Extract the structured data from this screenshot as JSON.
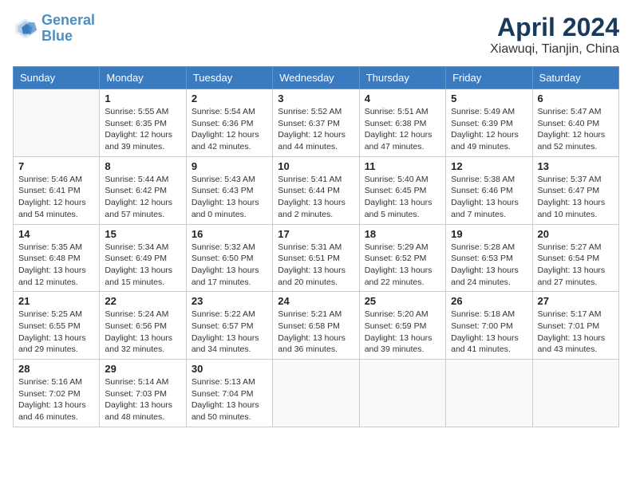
{
  "logo": {
    "text_general": "General",
    "text_blue": "Blue"
  },
  "title": "April 2024",
  "subtitle": "Xiawuqi, Tianjin, China",
  "days_of_week": [
    "Sunday",
    "Monday",
    "Tuesday",
    "Wednesday",
    "Thursday",
    "Friday",
    "Saturday"
  ],
  "weeks": [
    [
      {
        "day": "",
        "info": ""
      },
      {
        "day": "1",
        "info": "Sunrise: 5:55 AM\nSunset: 6:35 PM\nDaylight: 12 hours\nand 39 minutes."
      },
      {
        "day": "2",
        "info": "Sunrise: 5:54 AM\nSunset: 6:36 PM\nDaylight: 12 hours\nand 42 minutes."
      },
      {
        "day": "3",
        "info": "Sunrise: 5:52 AM\nSunset: 6:37 PM\nDaylight: 12 hours\nand 44 minutes."
      },
      {
        "day": "4",
        "info": "Sunrise: 5:51 AM\nSunset: 6:38 PM\nDaylight: 12 hours\nand 47 minutes."
      },
      {
        "day": "5",
        "info": "Sunrise: 5:49 AM\nSunset: 6:39 PM\nDaylight: 12 hours\nand 49 minutes."
      },
      {
        "day": "6",
        "info": "Sunrise: 5:47 AM\nSunset: 6:40 PM\nDaylight: 12 hours\nand 52 minutes."
      }
    ],
    [
      {
        "day": "7",
        "info": "Sunrise: 5:46 AM\nSunset: 6:41 PM\nDaylight: 12 hours\nand 54 minutes."
      },
      {
        "day": "8",
        "info": "Sunrise: 5:44 AM\nSunset: 6:42 PM\nDaylight: 12 hours\nand 57 minutes."
      },
      {
        "day": "9",
        "info": "Sunrise: 5:43 AM\nSunset: 6:43 PM\nDaylight: 13 hours\nand 0 minutes."
      },
      {
        "day": "10",
        "info": "Sunrise: 5:41 AM\nSunset: 6:44 PM\nDaylight: 13 hours\nand 2 minutes."
      },
      {
        "day": "11",
        "info": "Sunrise: 5:40 AM\nSunset: 6:45 PM\nDaylight: 13 hours\nand 5 minutes."
      },
      {
        "day": "12",
        "info": "Sunrise: 5:38 AM\nSunset: 6:46 PM\nDaylight: 13 hours\nand 7 minutes."
      },
      {
        "day": "13",
        "info": "Sunrise: 5:37 AM\nSunset: 6:47 PM\nDaylight: 13 hours\nand 10 minutes."
      }
    ],
    [
      {
        "day": "14",
        "info": "Sunrise: 5:35 AM\nSunset: 6:48 PM\nDaylight: 13 hours\nand 12 minutes."
      },
      {
        "day": "15",
        "info": "Sunrise: 5:34 AM\nSunset: 6:49 PM\nDaylight: 13 hours\nand 15 minutes."
      },
      {
        "day": "16",
        "info": "Sunrise: 5:32 AM\nSunset: 6:50 PM\nDaylight: 13 hours\nand 17 minutes."
      },
      {
        "day": "17",
        "info": "Sunrise: 5:31 AM\nSunset: 6:51 PM\nDaylight: 13 hours\nand 20 minutes."
      },
      {
        "day": "18",
        "info": "Sunrise: 5:29 AM\nSunset: 6:52 PM\nDaylight: 13 hours\nand 22 minutes."
      },
      {
        "day": "19",
        "info": "Sunrise: 5:28 AM\nSunset: 6:53 PM\nDaylight: 13 hours\nand 24 minutes."
      },
      {
        "day": "20",
        "info": "Sunrise: 5:27 AM\nSunset: 6:54 PM\nDaylight: 13 hours\nand 27 minutes."
      }
    ],
    [
      {
        "day": "21",
        "info": "Sunrise: 5:25 AM\nSunset: 6:55 PM\nDaylight: 13 hours\nand 29 minutes."
      },
      {
        "day": "22",
        "info": "Sunrise: 5:24 AM\nSunset: 6:56 PM\nDaylight: 13 hours\nand 32 minutes."
      },
      {
        "day": "23",
        "info": "Sunrise: 5:22 AM\nSunset: 6:57 PM\nDaylight: 13 hours\nand 34 minutes."
      },
      {
        "day": "24",
        "info": "Sunrise: 5:21 AM\nSunset: 6:58 PM\nDaylight: 13 hours\nand 36 minutes."
      },
      {
        "day": "25",
        "info": "Sunrise: 5:20 AM\nSunset: 6:59 PM\nDaylight: 13 hours\nand 39 minutes."
      },
      {
        "day": "26",
        "info": "Sunrise: 5:18 AM\nSunset: 7:00 PM\nDaylight: 13 hours\nand 41 minutes."
      },
      {
        "day": "27",
        "info": "Sunrise: 5:17 AM\nSunset: 7:01 PM\nDaylight: 13 hours\nand 43 minutes."
      }
    ],
    [
      {
        "day": "28",
        "info": "Sunrise: 5:16 AM\nSunset: 7:02 PM\nDaylight: 13 hours\nand 46 minutes."
      },
      {
        "day": "29",
        "info": "Sunrise: 5:14 AM\nSunset: 7:03 PM\nDaylight: 13 hours\nand 48 minutes."
      },
      {
        "day": "30",
        "info": "Sunrise: 5:13 AM\nSunset: 7:04 PM\nDaylight: 13 hours\nand 50 minutes."
      },
      {
        "day": "",
        "info": ""
      },
      {
        "day": "",
        "info": ""
      },
      {
        "day": "",
        "info": ""
      },
      {
        "day": "",
        "info": ""
      }
    ]
  ]
}
